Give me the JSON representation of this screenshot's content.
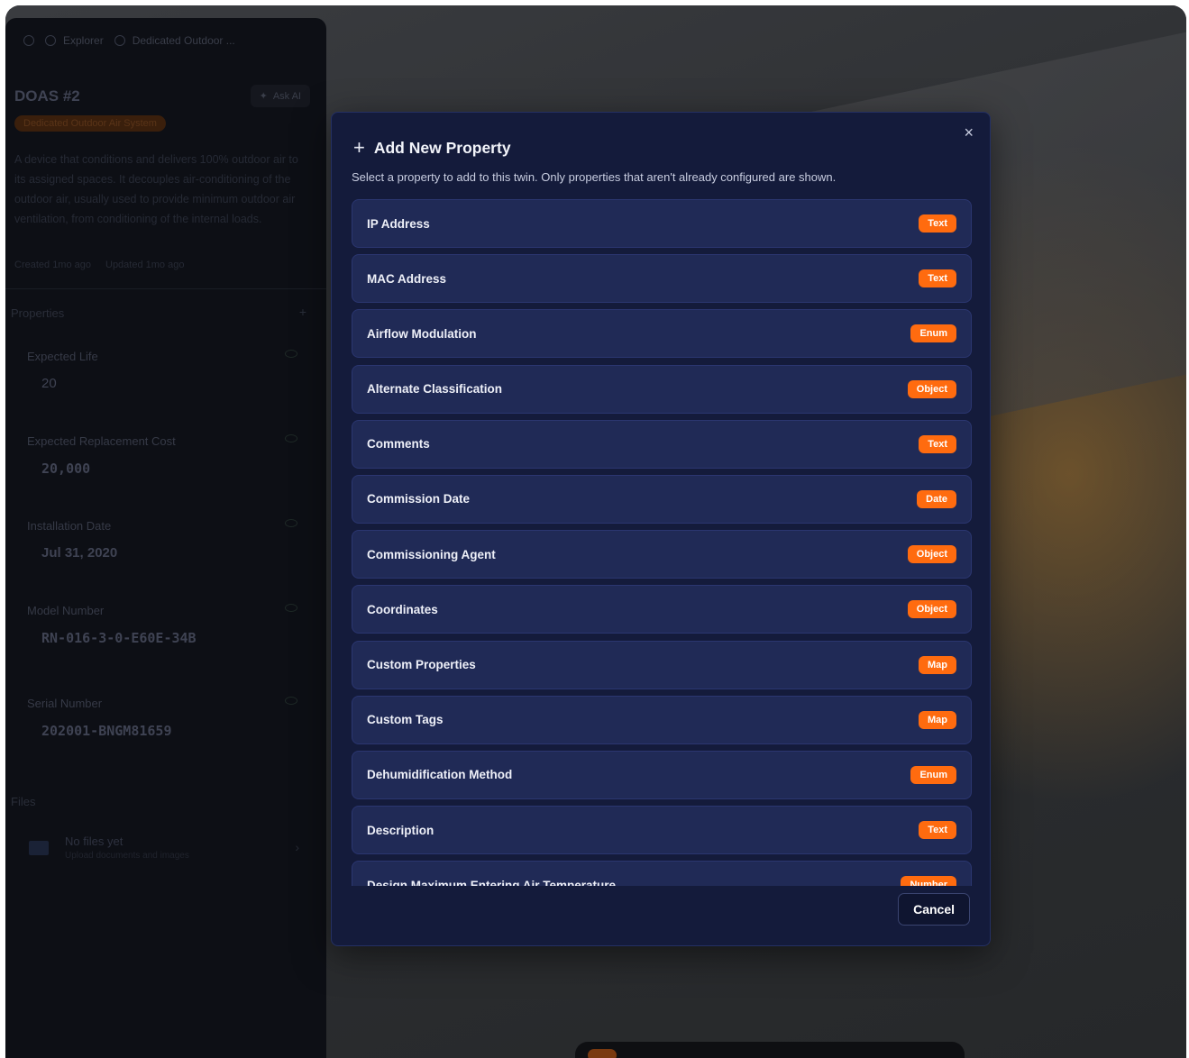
{
  "breadcrumbs": [
    "Explorer",
    "Dedicated Outdoor ..."
  ],
  "twin": {
    "title": "DOAS #2",
    "ask_ai": "Ask AI",
    "type": "Dedicated Outdoor Air System",
    "description": "A device that conditions and delivers 100% outdoor air to its assigned spaces. It decouples air-conditioning of the outdoor air, usually used to provide minimum outdoor air ventilation, from conditioning of the internal loads.",
    "created": "Created 1mo ago",
    "updated": "Updated 1mo ago"
  },
  "properties_section": {
    "heading": "Properties",
    "items": [
      {
        "label": "Expected Life",
        "value": "20"
      },
      {
        "label": "Expected Replacement Cost",
        "value": "20,000"
      },
      {
        "label": "Installation Date",
        "value": "Jul 31, 2020"
      },
      {
        "label": "Model Number",
        "value": "RN-016-3-0-E60E-34B"
      },
      {
        "label": "Serial Number",
        "value": "202001-BNGM81659"
      }
    ]
  },
  "files_section": {
    "heading": "Files",
    "empty_title": "No files yet",
    "empty_subtitle": "Upload documents and images"
  },
  "modal": {
    "title": "Add New Property",
    "subtitle": "Select a property to add to this twin. Only properties that aren't already configured are shown.",
    "close_icon": "×",
    "options": [
      {
        "label": "IP Address",
        "type": "Text"
      },
      {
        "label": "MAC Address",
        "type": "Text"
      },
      {
        "label": "Airflow Modulation",
        "type": "Enum"
      },
      {
        "label": "Alternate Classification",
        "type": "Object"
      },
      {
        "label": "Comments",
        "type": "Text"
      },
      {
        "label": "Commission Date",
        "type": "Date"
      },
      {
        "label": "Commissioning Agent",
        "type": "Object"
      },
      {
        "label": "Coordinates",
        "type": "Object"
      },
      {
        "label": "Custom Properties",
        "type": "Map"
      },
      {
        "label": "Custom Tags",
        "type": "Map"
      },
      {
        "label": "Dehumidification Method",
        "type": "Enum"
      },
      {
        "label": "Description",
        "type": "Text"
      },
      {
        "label": "Design Maximum Entering Air Temperature",
        "type": "Number"
      }
    ],
    "cancel_label": "Cancel"
  },
  "colors": {
    "accent": "#ff6b0f",
    "modal_bg": "#141b3b",
    "row_bg": "#202a56"
  }
}
